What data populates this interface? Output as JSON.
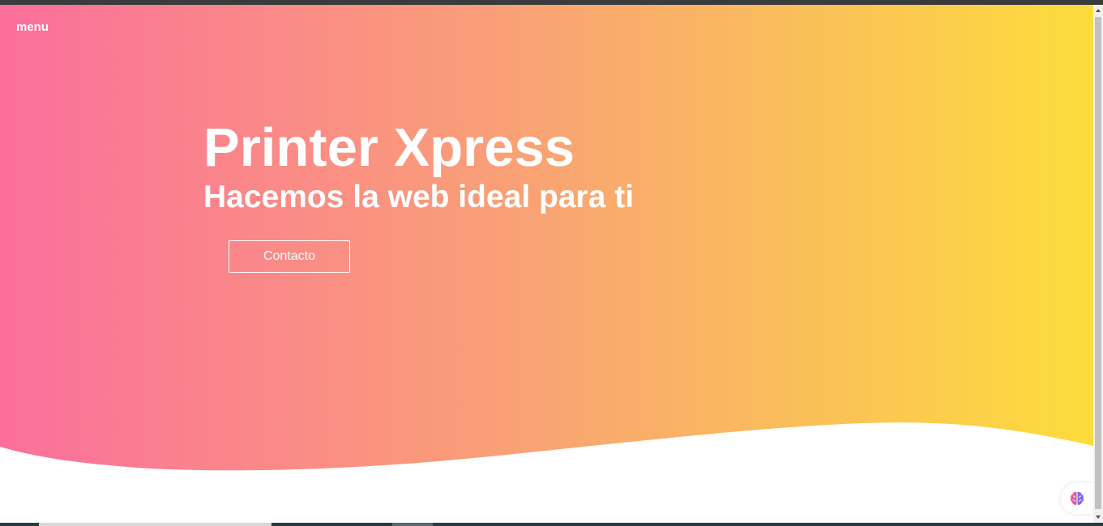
{
  "nav": {
    "menu_label": "menu"
  },
  "hero": {
    "title": "Printer Xpress",
    "subtitle": "Hacemos la web ideal para ti",
    "cta_label": "Contacto",
    "gradient_start": "#fb6f9c",
    "gradient_mid": "#f9a473",
    "gradient_end": "#fcdd3c"
  },
  "widget": {
    "icon": "brain-icon"
  }
}
